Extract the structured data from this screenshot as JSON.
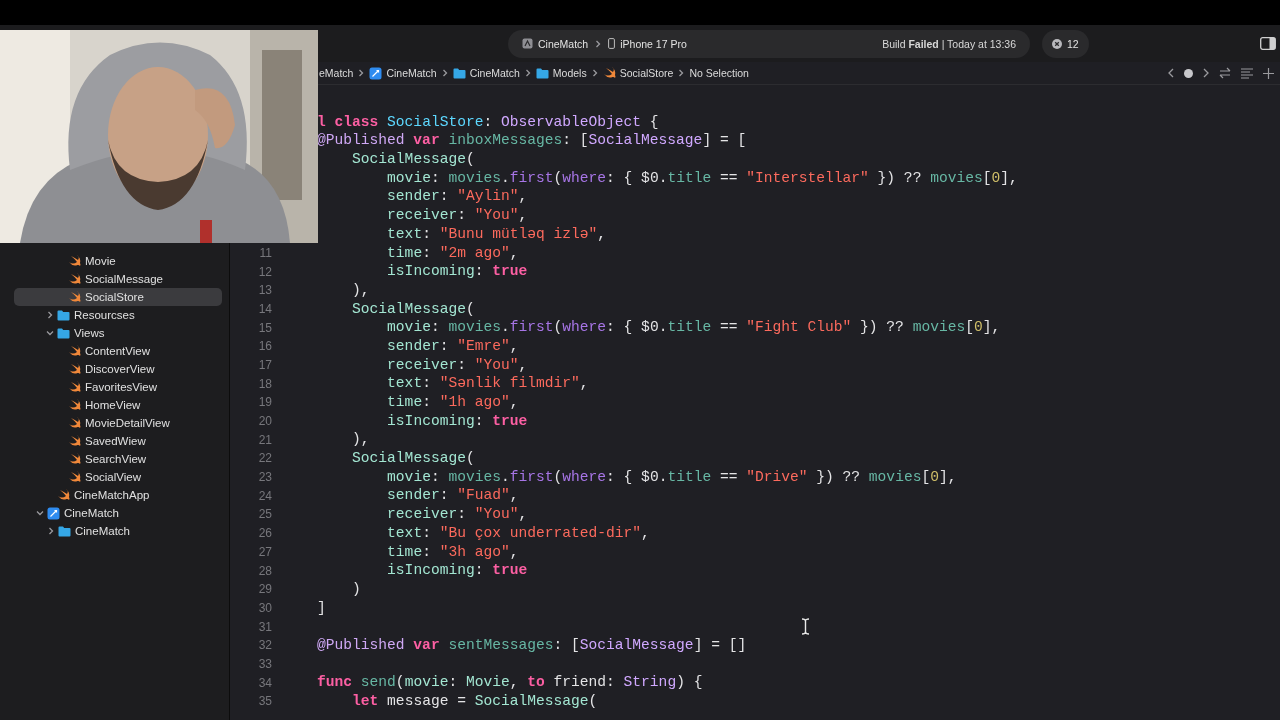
{
  "toolbar": {
    "scheme": "CineMatch",
    "destination": "iPhone 17 Pro",
    "status": "Build **Failed** | Today at 13:36",
    "issues": "12"
  },
  "navigator": {
    "items": [
      {
        "kind": "folder",
        "children": [
          {
            "label": "Movie",
            "kind": "swift",
            "selected": false
          },
          {
            "label": "SocialMessage",
            "kind": "swift",
            "selected": false
          },
          {
            "label": "SocialStore",
            "kind": "swift",
            "selected": true
          }
        ]
      },
      {
        "label": "Resourcses",
        "kind": "folder",
        "expanded": false,
        "selected": false
      },
      {
        "label": "Views",
        "kind": "folder",
        "expanded": true,
        "selected": false,
        "children": [
          {
            "label": "ContentView",
            "kind": "swift",
            "selected": false
          },
          {
            "label": "DiscoverView",
            "kind": "swift",
            "selected": false
          },
          {
            "label": "FavoritesView",
            "kind": "swift",
            "selected": false
          },
          {
            "label": "HomeView",
            "kind": "swift",
            "selected": false
          },
          {
            "label": "MovieDetailView",
            "kind": "swift",
            "selected": false
          },
          {
            "label": "SavedWiew",
            "kind": "swift",
            "selected": false
          },
          {
            "label": "SearchView",
            "kind": "swift",
            "selected": false
          },
          {
            "label": "SocialView",
            "kind": "swift",
            "selected": false
          }
        ]
      },
      {
        "label": "CineMatchApp",
        "kind": "swift",
        "selected": false
      },
      {
        "label": "CineMatch",
        "kind": "project",
        "expanded": true,
        "selected": false,
        "children": [
          {
            "label": "CineMatch",
            "kind": "folder",
            "expanded": false,
            "selected": false
          }
        ]
      }
    ]
  },
  "breadcrumb": [
    {
      "label": "eMatch",
      "kind": "cut"
    },
    {
      "label": "CineMatch",
      "kind": "project"
    },
    {
      "label": "CineMatch",
      "kind": "folder"
    },
    {
      "label": "Models",
      "kind": "folder"
    },
    {
      "label": "SocialStore",
      "kind": "swift"
    },
    {
      "label": "No Selection",
      "kind": "none"
    }
  ],
  "code": [
    {
      "tokens": [
        {
          "kind": "kw",
          "text": "    l class"
        },
        {
          "kind": "decl",
          "text": " SocialStore"
        },
        {
          "kind": "plain",
          "text": ": "
        },
        {
          "kind": "type",
          "text": "ObservableObject"
        },
        {
          "kind": "plain",
          "text": " {"
        }
      ]
    },
    {
      "tokens": [
        {
          "kind": "attr",
          "text": "    @Published"
        },
        {
          "kind": "kw",
          "text": " var"
        },
        {
          "kind": "ident",
          "text": " inboxMessages"
        },
        {
          "kind": "plain",
          "text": ": ["
        },
        {
          "kind": "type",
          "text": "SocialMessage"
        },
        {
          "kind": "plain",
          "text": "] = ["
        }
      ]
    },
    {
      "tokens": [
        {
          "kind": "label",
          "text": "        SocialMessage"
        },
        {
          "kind": "plain",
          "text": "("
        }
      ]
    },
    {
      "tokens": [
        {
          "kind": "label",
          "text": "            movie"
        },
        {
          "kind": "plain",
          "text": ": "
        },
        {
          "kind": "ident",
          "text": "movies"
        },
        {
          "kind": "plain",
          "text": "."
        },
        {
          "kind": "call",
          "text": "first"
        },
        {
          "kind": "plain",
          "text": "("
        },
        {
          "kind": "call",
          "text": "where"
        },
        {
          "kind": "plain",
          "text": ": { $0."
        },
        {
          "kind": "ident",
          "text": "title"
        },
        {
          "kind": "plain",
          "text": " == "
        },
        {
          "kind": "str",
          "text": "\"Interstellar\""
        },
        {
          "kind": "plain",
          "text": " }) ?? "
        },
        {
          "kind": "ident",
          "text": "movies"
        },
        {
          "kind": "plain",
          "text": "["
        },
        {
          "kind": "num",
          "text": "0"
        },
        {
          "kind": "plain",
          "text": "],"
        }
      ]
    },
    {
      "tokens": [
        {
          "kind": "label",
          "text": "            sender"
        },
        {
          "kind": "plain",
          "text": ": "
        },
        {
          "kind": "str",
          "text": "\"Aylin\""
        },
        {
          "kind": "plain",
          "text": ","
        }
      ]
    },
    {
      "tokens": [
        {
          "kind": "label",
          "text": "            receiver"
        },
        {
          "kind": "plain",
          "text": ": "
        },
        {
          "kind": "str",
          "text": "\"You\""
        },
        {
          "kind": "plain",
          "text": ","
        }
      ]
    },
    {
      "tokens": [
        {
          "kind": "label",
          "text": "            text"
        },
        {
          "kind": "plain",
          "text": ": "
        },
        {
          "kind": "str",
          "text": "\"Bunu mütləq izlə\""
        },
        {
          "kind": "plain",
          "text": ","
        }
      ]
    },
    {
      "number": "11",
      "tokens": [
        {
          "kind": "label",
          "text": "            time"
        },
        {
          "kind": "plain",
          "text": ": "
        },
        {
          "kind": "str",
          "text": "\"2m ago\""
        },
        {
          "kind": "plain",
          "text": ","
        }
      ]
    },
    {
      "number": "12",
      "tokens": [
        {
          "kind": "label",
          "text": "            isIncoming"
        },
        {
          "kind": "plain",
          "text": ": "
        },
        {
          "kind": "kw",
          "text": "true"
        }
      ]
    },
    {
      "number": "13",
      "tokens": [
        {
          "kind": "plain",
          "text": "        ),"
        }
      ]
    },
    {
      "number": "14",
      "tokens": [
        {
          "kind": "label",
          "text": "        SocialMessage"
        },
        {
          "kind": "plain",
          "text": "("
        }
      ]
    },
    {
      "number": "15",
      "tokens": [
        {
          "kind": "label",
          "text": "            movie"
        },
        {
          "kind": "plain",
          "text": ": "
        },
        {
          "kind": "ident",
          "text": "movies"
        },
        {
          "kind": "plain",
          "text": "."
        },
        {
          "kind": "call",
          "text": "first"
        },
        {
          "kind": "plain",
          "text": "("
        },
        {
          "kind": "call",
          "text": "where"
        },
        {
          "kind": "plain",
          "text": ": { $0."
        },
        {
          "kind": "ident",
          "text": "title"
        },
        {
          "kind": "plain",
          "text": " == "
        },
        {
          "kind": "str",
          "text": "\"Fight Club\""
        },
        {
          "kind": "plain",
          "text": " }) ?? "
        },
        {
          "kind": "ident",
          "text": "movies"
        },
        {
          "kind": "plain",
          "text": "["
        },
        {
          "kind": "num",
          "text": "0"
        },
        {
          "kind": "plain",
          "text": "],"
        }
      ]
    },
    {
      "number": "16",
      "tokens": [
        {
          "kind": "label",
          "text": "            sender"
        },
        {
          "kind": "plain",
          "text": ": "
        },
        {
          "kind": "str",
          "text": "\"Emre\""
        },
        {
          "kind": "plain",
          "text": ","
        }
      ]
    },
    {
      "number": "17",
      "tokens": [
        {
          "kind": "label",
          "text": "            receiver"
        },
        {
          "kind": "plain",
          "text": ": "
        },
        {
          "kind": "str",
          "text": "\"You\""
        },
        {
          "kind": "plain",
          "text": ","
        }
      ]
    },
    {
      "number": "18",
      "tokens": [
        {
          "kind": "label",
          "text": "            text"
        },
        {
          "kind": "plain",
          "text": ": "
        },
        {
          "kind": "str",
          "text": "\"Sənlik filmdir\""
        },
        {
          "kind": "plain",
          "text": ","
        }
      ]
    },
    {
      "number": "19",
      "tokens": [
        {
          "kind": "label",
          "text": "            time"
        },
        {
          "kind": "plain",
          "text": ": "
        },
        {
          "kind": "str",
          "text": "\"1h ago\""
        },
        {
          "kind": "plain",
          "text": ","
        }
      ]
    },
    {
      "number": "20",
      "tokens": [
        {
          "kind": "label",
          "text": "            isIncoming"
        },
        {
          "kind": "plain",
          "text": ": "
        },
        {
          "kind": "kw",
          "text": "true"
        }
      ]
    },
    {
      "number": "21",
      "tokens": [
        {
          "kind": "plain",
          "text": "        ),"
        }
      ]
    },
    {
      "number": "22",
      "tokens": [
        {
          "kind": "label",
          "text": "        SocialMessage"
        },
        {
          "kind": "plain",
          "text": "("
        }
      ]
    },
    {
      "number": "23",
      "tokens": [
        {
          "kind": "label",
          "text": "            movie"
        },
        {
          "kind": "plain",
          "text": ": "
        },
        {
          "kind": "ident",
          "text": "movies"
        },
        {
          "kind": "plain",
          "text": "."
        },
        {
          "kind": "call",
          "text": "first"
        },
        {
          "kind": "plain",
          "text": "("
        },
        {
          "kind": "call",
          "text": "where"
        },
        {
          "kind": "plain",
          "text": ": { $0."
        },
        {
          "kind": "ident",
          "text": "title"
        },
        {
          "kind": "plain",
          "text": " == "
        },
        {
          "kind": "str",
          "text": "\"Drive\""
        },
        {
          "kind": "plain",
          "text": " }) ?? "
        },
        {
          "kind": "ident",
          "text": "movies"
        },
        {
          "kind": "plain",
          "text": "["
        },
        {
          "kind": "num",
          "text": "0"
        },
        {
          "kind": "plain",
          "text": "],"
        }
      ]
    },
    {
      "number": "24",
      "tokens": [
        {
          "kind": "label",
          "text": "            sender"
        },
        {
          "kind": "plain",
          "text": ": "
        },
        {
          "kind": "str",
          "text": "\"Fuad\""
        },
        {
          "kind": "plain",
          "text": ","
        }
      ]
    },
    {
      "number": "25",
      "tokens": [
        {
          "kind": "label",
          "text": "            receiver"
        },
        {
          "kind": "plain",
          "text": ": "
        },
        {
          "kind": "str",
          "text": "\"You\""
        },
        {
          "kind": "plain",
          "text": ","
        }
      ]
    },
    {
      "number": "26",
      "tokens": [
        {
          "kind": "label",
          "text": "            text"
        },
        {
          "kind": "plain",
          "text": ": "
        },
        {
          "kind": "str",
          "text": "\"Bu çox underrated-dir\""
        },
        {
          "kind": "plain",
          "text": ","
        }
      ]
    },
    {
      "number": "27",
      "tokens": [
        {
          "kind": "label",
          "text": "            time"
        },
        {
          "kind": "plain",
          "text": ": "
        },
        {
          "kind": "str",
          "text": "\"3h ago\""
        },
        {
          "kind": "plain",
          "text": ","
        }
      ]
    },
    {
      "number": "28",
      "tokens": [
        {
          "kind": "label",
          "text": "            isIncoming"
        },
        {
          "kind": "plain",
          "text": ": "
        },
        {
          "kind": "kw",
          "text": "true"
        }
      ]
    },
    {
      "number": "29",
      "tokens": [
        {
          "kind": "plain",
          "text": "        )"
        }
      ]
    },
    {
      "number": "30",
      "tokens": [
        {
          "kind": "plain",
          "text": "    ]"
        }
      ]
    },
    {
      "number": "31"
    },
    {
      "number": "32",
      "tokens": [
        {
          "kind": "attr",
          "text": "    @Published"
        },
        {
          "kind": "kw",
          "text": " var"
        },
        {
          "kind": "ident",
          "text": " sentMessages"
        },
        {
          "kind": "plain",
          "text": ": ["
        },
        {
          "kind": "type",
          "text": "SocialMessage"
        },
        {
          "kind": "plain",
          "text": "] = []"
        }
      ]
    },
    {
      "number": "33"
    },
    {
      "number": "34",
      "tokens": [
        {
          "kind": "kw",
          "text": "    func"
        },
        {
          "kind": "ident",
          "text": " send"
        },
        {
          "kind": "plain",
          "text": "("
        },
        {
          "kind": "label",
          "text": "movie"
        },
        {
          "kind": "plain",
          "text": ": "
        },
        {
          "kind": "label",
          "text": "Movie"
        },
        {
          "kind": "plain",
          "text": ", "
        },
        {
          "kind": "kw",
          "text": "to"
        },
        {
          "kind": "plain",
          "text": " friend: "
        },
        {
          "kind": "type",
          "text": "String"
        },
        {
          "kind": "plain",
          "text": ") {"
        }
      ]
    },
    {
      "number": "35",
      "tokens": [
        {
          "kind": "kw",
          "text": "        let"
        },
        {
          "kind": "plain",
          "text": " message = "
        },
        {
          "kind": "label",
          "text": "SocialMessage"
        },
        {
          "kind": "plain",
          "text": "("
        }
      ]
    }
  ]
}
